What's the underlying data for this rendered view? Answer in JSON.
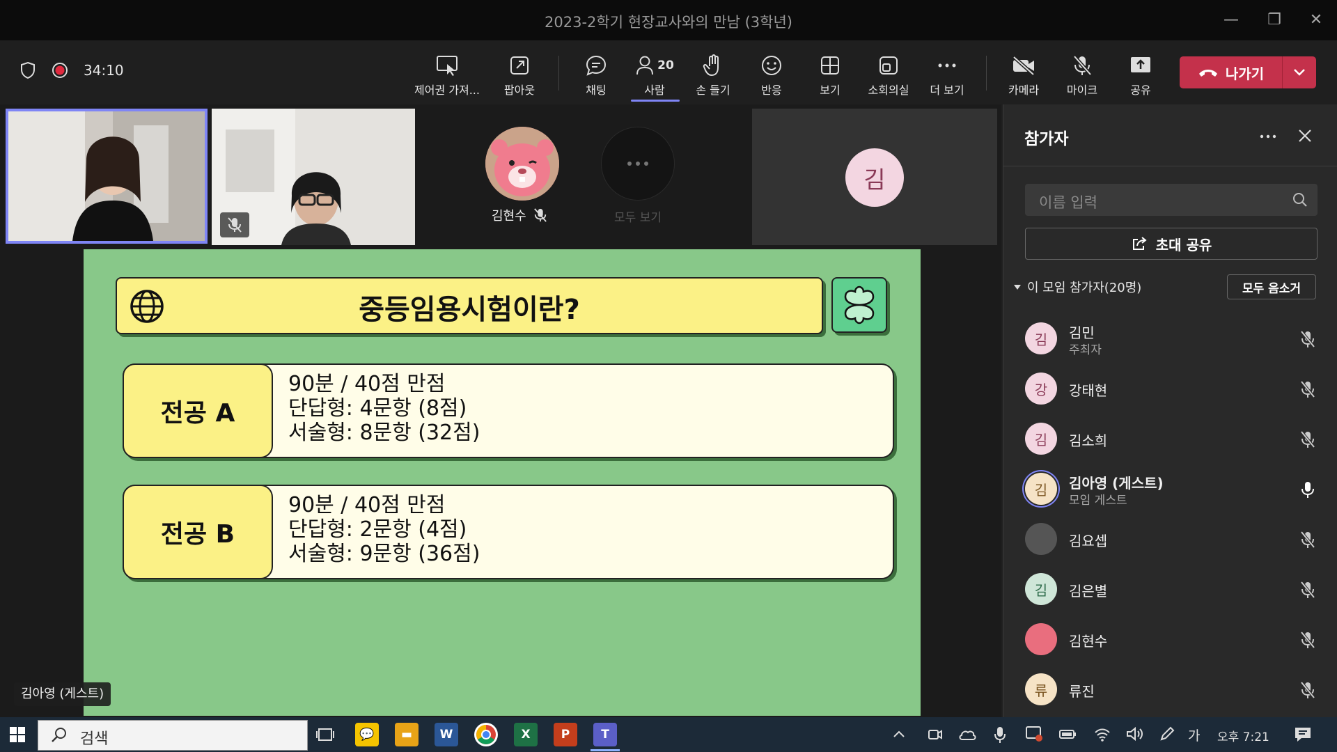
{
  "window": {
    "title": "2023-2학기 현장교사와의 만남 (3학년)"
  },
  "toolbar": {
    "timer": "34:10",
    "buttons": [
      {
        "label": "제어권 가져..."
      },
      {
        "label": "팝아웃"
      },
      {
        "label": "채팅"
      },
      {
        "label": "사람",
        "count": "20"
      },
      {
        "label": "손 들기"
      },
      {
        "label": "반응"
      },
      {
        "label": "보기"
      },
      {
        "label": "소회의실"
      },
      {
        "label": "더 보기"
      },
      {
        "label": "카메라"
      },
      {
        "label": "마이크"
      },
      {
        "label": "공유"
      }
    ],
    "leave_label": "나가기"
  },
  "gallery": {
    "member_name": "김현수",
    "see_all": "모두 보기",
    "big_avatar_initial": "김"
  },
  "slide": {
    "title": "중등임용시험이란?",
    "cards": [
      {
        "tag": "전공 A",
        "lines": [
          "90분 / 40점 만점",
          "단답형: 4문항 (8점)",
          "서술형: 8문항 (32점)"
        ]
      },
      {
        "tag": "전공 B",
        "lines": [
          "90분 / 40점 만점",
          "단답형: 2문항 (4점)",
          "서술형: 9문항 (36점)"
        ]
      }
    ]
  },
  "self_name": "김아영 (게스트)",
  "panel": {
    "title": "참가자",
    "search_placeholder": "이름 입력",
    "invite_label": "초대 공유",
    "section_label": "이 모임 참가자(20명)",
    "mute_all_label": "모두 음소거",
    "participants": [
      {
        "initial": "김",
        "name": "김민",
        "sub": "주최자",
        "avatar": "#f3d6e1",
        "fg": "#8a3a57"
      },
      {
        "initial": "강",
        "name": "강태현",
        "sub": "",
        "avatar": "#f3d6e1",
        "fg": "#8a3a57"
      },
      {
        "initial": "김",
        "name": "김소희",
        "sub": "",
        "avatar": "#f3d6e1",
        "fg": "#8a3a57"
      },
      {
        "initial": "김",
        "name": "김아영 (게스트)",
        "sub": "모임 게스트",
        "avatar": "#f6e3c6",
        "fg": "#7a5420"
      },
      {
        "initial": "",
        "name": "김요셉",
        "sub": "",
        "avatar": "#555555",
        "fg": "#ffffff"
      },
      {
        "initial": "김",
        "name": "김은별",
        "sub": "",
        "avatar": "#cfe6d8",
        "fg": "#2e6b4a"
      },
      {
        "initial": "",
        "name": "김현수",
        "sub": "",
        "avatar": "#e96e7e",
        "fg": "#ffffff"
      },
      {
        "initial": "류",
        "name": "류진",
        "sub": "",
        "avatar": "#f6e3c6",
        "fg": "#7a5420"
      }
    ]
  },
  "taskbar": {
    "search_label": "검색",
    "ime": "가",
    "clock": "오후 7:21"
  }
}
